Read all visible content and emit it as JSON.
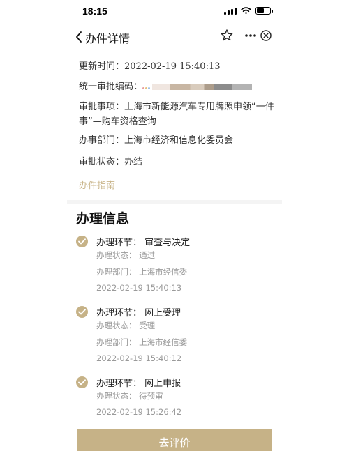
{
  "status_bar": {
    "time": "18:15"
  },
  "nav": {
    "title": "办件详情"
  },
  "details": {
    "update_time_label": "更新时间：",
    "update_time_value": "2022-02-19 15:40:13",
    "approval_code_label": "统一审批编码：",
    "item_label": "审批事项：",
    "item_value_line1": "上海市新能源汽车专用牌照申领“一件",
    "item_value_line2": "事”—购车资格查询",
    "department_label": "办事部门：",
    "department_value": "上海市经济和信息化委员会",
    "status_label": "审批状态：",
    "status_value": "办结",
    "guide_link": "办件指南"
  },
  "processing": {
    "section_title": "办理信息",
    "steps": [
      {
        "title": "办理环节：  审查与决定",
        "status": "办理状态：  通过",
        "department": "办理部门：  上海市经信委",
        "time": "2022-02-19 15:40:13"
      },
      {
        "title": "办理环节：  网上受理",
        "status": "办理状态：  受理",
        "department": "办理部门：  上海市经信委",
        "time": "2022-02-19 15:40:12"
      },
      {
        "title": "办理环节：  网上申报",
        "status": "办理状态：  待预审",
        "time": "2022-02-19 15:26:42"
      }
    ]
  },
  "footer": {
    "evaluate_button": "去评价"
  },
  "colors": {
    "accent": "#c6b287",
    "link": "#c9b58a"
  }
}
